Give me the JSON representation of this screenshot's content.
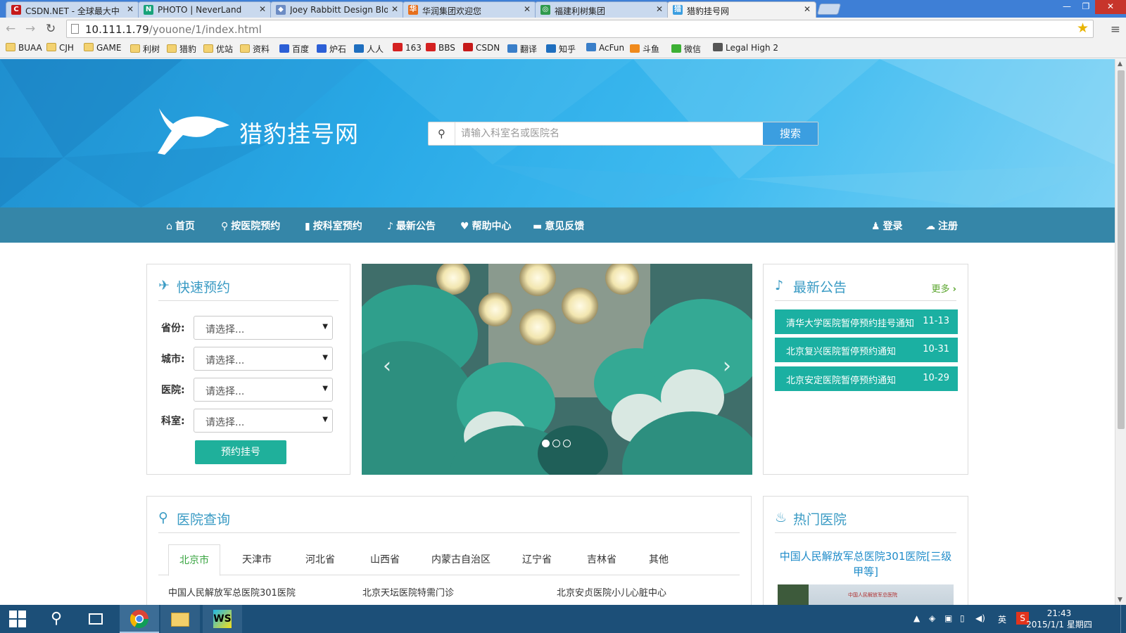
{
  "browser": {
    "tabs": [
      {
        "title": "CSDN.NET - 全球最大中",
        "favicon": "C",
        "color": "#c61a1a"
      },
      {
        "title": "PHOTO | NeverLand",
        "favicon": "N",
        "color": "#19a37a"
      },
      {
        "title": "Joey Rabbitt Design Blo",
        "favicon": "◆",
        "color": "#6c8cc4"
      },
      {
        "title": "华润集团欢迎您",
        "favicon": "华",
        "color": "#e6701e"
      },
      {
        "title": "福建利树集团",
        "favicon": "◎",
        "color": "#2f9a4d"
      },
      {
        "title": "猎豹挂号网",
        "favicon": "猎",
        "color": "#3b9ee0"
      }
    ],
    "tab_close": "✕",
    "window_controls": [
      "—",
      "❐",
      "✕"
    ],
    "url_host": "10.111.1.79",
    "url_path": "/youone/1/index.html",
    "bookmarks": [
      {
        "label": "BUAA",
        "icon": "folder-icon"
      },
      {
        "label": "CJH",
        "icon": "folder-icon"
      },
      {
        "label": "GAME",
        "icon": "folder-icon"
      },
      {
        "label": "利树",
        "icon": "folder-icon"
      },
      {
        "label": "猎豹",
        "icon": "folder-icon"
      },
      {
        "label": "优站",
        "icon": "folder-icon"
      },
      {
        "label": "资料",
        "icon": "folder-icon"
      },
      {
        "label": "百度",
        "icon": "baidu-icon",
        "color": "#2c5fd6"
      },
      {
        "label": "炉石",
        "icon": "baidu-icon",
        "color": "#2c5fd6"
      },
      {
        "label": "人人",
        "icon": "renren-icon",
        "color": "#1f6fbf"
      },
      {
        "label": "163",
        "icon": "netease-icon",
        "color": "#d42121"
      },
      {
        "label": "BBS",
        "icon": "netease-icon",
        "color": "#d42121"
      },
      {
        "label": "CSDN",
        "icon": "csdn-icon",
        "color": "#c61a1a"
      },
      {
        "label": "翻译",
        "icon": "translate-icon",
        "color": "#3a7fc9"
      },
      {
        "label": "知乎",
        "icon": "zhihu-icon",
        "color": "#1f6fbf"
      },
      {
        "label": "AcFun",
        "icon": "acfun-icon",
        "color": "#3a7fc9"
      },
      {
        "label": "斗鱼",
        "icon": "douyu-icon",
        "color": "#f08a1c"
      },
      {
        "label": "微信",
        "icon": "wechat-icon",
        "color": "#3cb034"
      },
      {
        "label": "Legal High 2",
        "icon": "tv-icon",
        "color": "#555555"
      }
    ]
  },
  "site": {
    "title": "猎豹挂号网",
    "search": {
      "placeholder": "请输入科室名或医院名",
      "button": "搜索"
    },
    "nav": [
      {
        "label": "首页",
        "icon": "home-icon",
        "glyph": "⌂"
      },
      {
        "label": "按医院预约",
        "icon": "map-marker-icon",
        "glyph": "⚲"
      },
      {
        "label": "按科室预约",
        "icon": "bookmark-icon",
        "glyph": "▮"
      },
      {
        "label": "最新公告",
        "icon": "bell-icon",
        "glyph": "♪"
      },
      {
        "label": "帮助中心",
        "icon": "heart-icon",
        "glyph": "♥"
      },
      {
        "label": "意见反馈",
        "icon": "comment-icon",
        "glyph": "▬"
      }
    ],
    "auth": [
      {
        "label": "登录",
        "icon": "user-icon",
        "glyph": "♟"
      },
      {
        "label": "注册",
        "icon": "cloud-icon",
        "glyph": "☁"
      }
    ]
  },
  "quick_booking": {
    "title": "快速预约",
    "fields": [
      {
        "label": "省份:",
        "value": "请选择..."
      },
      {
        "label": "城市:",
        "value": "请选择..."
      },
      {
        "label": "医院:",
        "value": "请选择..."
      },
      {
        "label": "科室:",
        "value": "请选择..."
      }
    ],
    "button": "预约挂号"
  },
  "carousel": {
    "slides": 3,
    "active": 0,
    "prev": "‹",
    "next": "›"
  },
  "notices": {
    "title": "最新公告",
    "more": "更多",
    "items": [
      {
        "text": "清华大学医院暂停预约挂号通知",
        "date": "11-13"
      },
      {
        "text": "北京复兴医院暂停预约通知",
        "date": "10-31"
      },
      {
        "text": "北京安定医院暂停预约通知",
        "date": "10-29"
      }
    ]
  },
  "hospital_search": {
    "title": "医院查询",
    "regions": [
      "北京市",
      "天津市",
      "河北省",
      "山西省",
      "内蒙古自治区",
      "辽宁省",
      "吉林省",
      "其他"
    ],
    "active_region": 0,
    "hospitals": [
      "中国人民解放军总医院301医院",
      "北京天坛医院特需门诊",
      "北京安贞医院小儿心脏中心"
    ]
  },
  "hot_hospitals": {
    "title": "热门医院",
    "name": "中国人民解放军总医院301医院[三级甲等]",
    "image_caption": "中国人民解放军总医院"
  },
  "taskbar": {
    "time": "21:43",
    "date": "2015/1/1 星期四",
    "ime": "英"
  },
  "colors": {
    "hero": "#29a9e6",
    "nav": "#247ca1",
    "accent_teal": "#1bb0a2",
    "link_blue": "#1e8bc9",
    "heading_blue": "#3a9bc4",
    "more_green": "#5aa52d",
    "taskbar": "#1c4f78"
  }
}
